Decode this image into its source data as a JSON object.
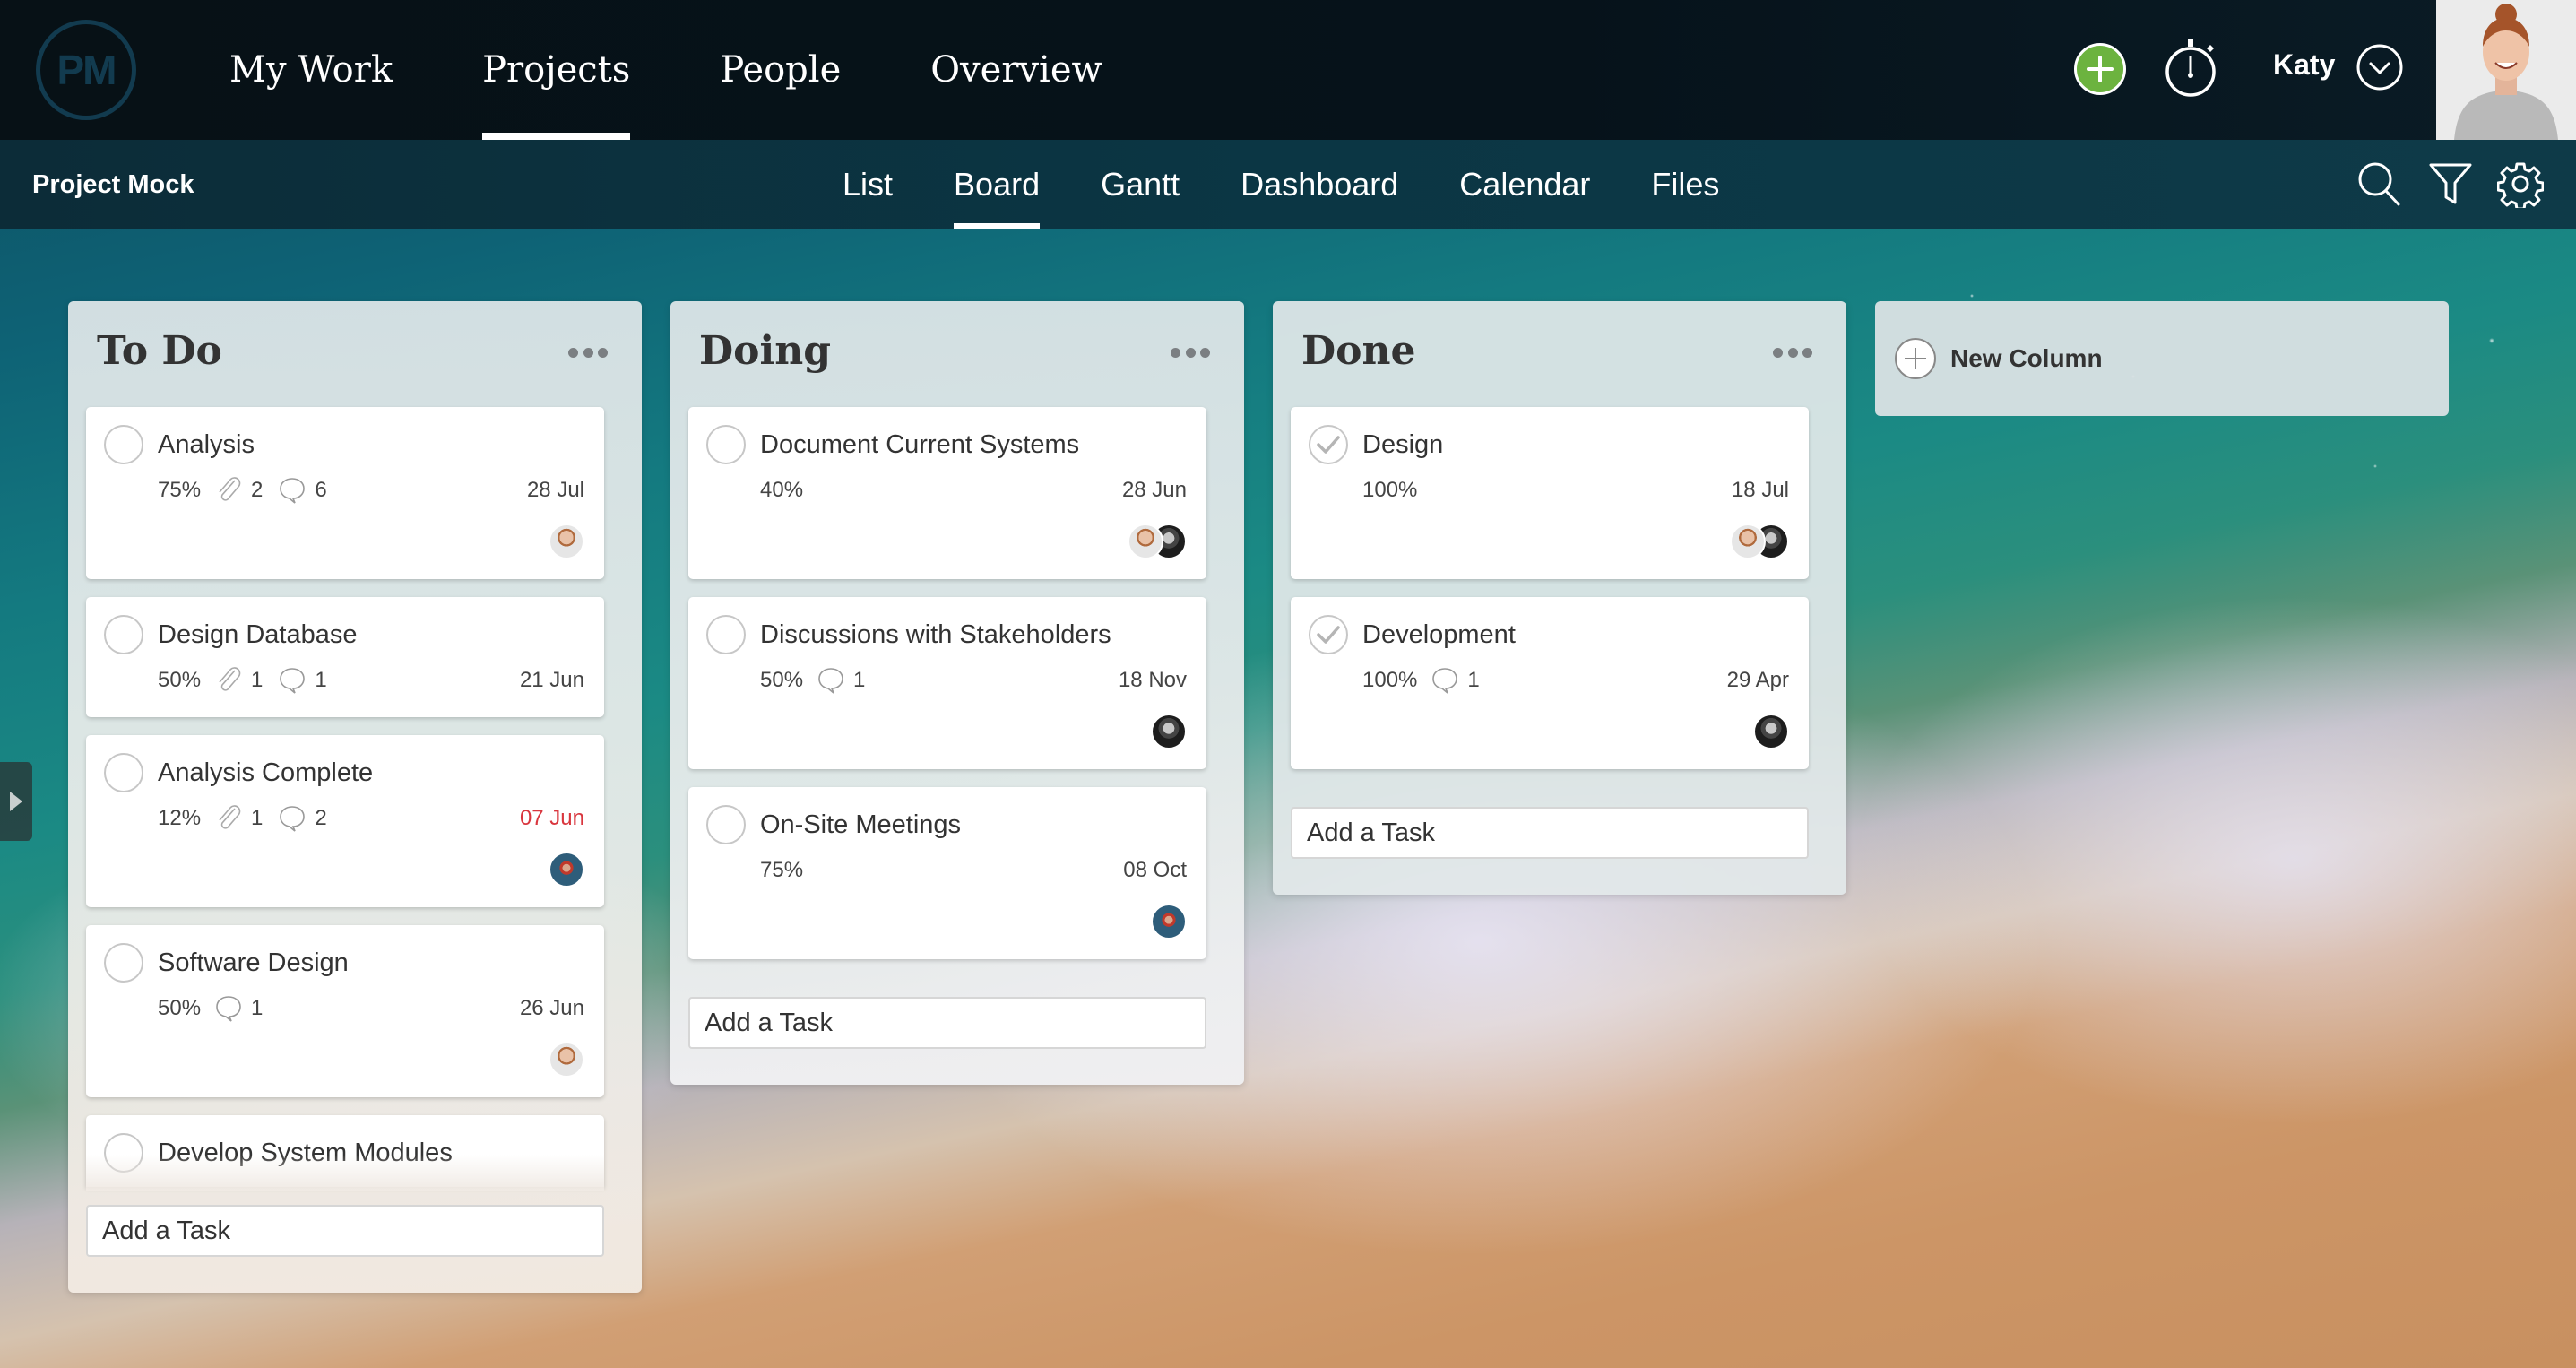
{
  "app": {
    "logo_text": "PM"
  },
  "main_nav": {
    "items": [
      {
        "label": "My Work",
        "active": false
      },
      {
        "label": "Projects",
        "active": true
      },
      {
        "label": "People",
        "active": false
      },
      {
        "label": "Overview",
        "active": false
      }
    ]
  },
  "header_actions": {
    "add_icon": "plus-circle-icon",
    "timer_icon": "stopwatch-icon",
    "user_name": "Katy",
    "user_menu_icon": "chevron-down-circle-icon",
    "add_color": "#6cb33f"
  },
  "project": {
    "name": "Project Mock"
  },
  "view_tabs": [
    {
      "label": "List",
      "active": false
    },
    {
      "label": "Board",
      "active": true
    },
    {
      "label": "Gantt",
      "active": false
    },
    {
      "label": "Dashboard",
      "active": false
    },
    {
      "label": "Calendar",
      "active": false
    },
    {
      "label": "Files",
      "active": false
    }
  ],
  "toolbar_icons": [
    "search-icon",
    "filter-icon",
    "gear-icon"
  ],
  "board": {
    "add_task_placeholder": "Add a Task",
    "new_column_label": "New Column",
    "overdue_color": "#d9363e",
    "columns": [
      {
        "title": "To Do",
        "cards": [
          {
            "title": "Analysis",
            "progress": "75%",
            "attachments": "2",
            "comments": "6",
            "due": "28 Jul",
            "overdue": false,
            "done": false,
            "assignees": [
              "katy"
            ]
          },
          {
            "title": "Design Database",
            "progress": "50%",
            "attachments": "1",
            "comments": "1",
            "due": "21 Jun",
            "overdue": false,
            "done": false,
            "assignees": []
          },
          {
            "title": "Analysis Complete",
            "progress": "12%",
            "attachments": "1",
            "comments": "2",
            "due": "07 Jun",
            "overdue": true,
            "done": false,
            "assignees": [
              "beach"
            ]
          },
          {
            "title": "Software Design",
            "progress": "50%",
            "attachments": null,
            "comments": "1",
            "due": "26 Jun",
            "overdue": false,
            "done": false,
            "assignees": [
              "katy"
            ]
          },
          {
            "title": "Develop System Modules",
            "progress": null,
            "attachments": null,
            "comments": null,
            "due": null,
            "overdue": false,
            "done": false,
            "assignees": []
          }
        ]
      },
      {
        "title": "Doing",
        "cards": [
          {
            "title": "Document Current Systems",
            "progress": "40%",
            "attachments": null,
            "comments": null,
            "due": "28 Jun",
            "overdue": false,
            "done": false,
            "assignees": [
              "katy",
              "brahms"
            ]
          },
          {
            "title": "Discussions with Stakeholders",
            "progress": "50%",
            "attachments": null,
            "comments": "1",
            "due": "18 Nov",
            "overdue": false,
            "done": false,
            "assignees": [
              "brahms"
            ]
          },
          {
            "title": "On-Site Meetings",
            "progress": "75%",
            "attachments": null,
            "comments": null,
            "due": "08 Oct",
            "overdue": false,
            "done": false,
            "assignees": [
              "beach"
            ]
          }
        ]
      },
      {
        "title": "Done",
        "cards": [
          {
            "title": "Design",
            "progress": "100%",
            "attachments": null,
            "comments": null,
            "due": "18 Jul",
            "overdue": false,
            "done": true,
            "assignees": [
              "katy",
              "brahms"
            ]
          },
          {
            "title": "Development",
            "progress": "100%",
            "attachments": null,
            "comments": "1",
            "due": "29 Apr",
            "overdue": false,
            "done": true,
            "assignees": [
              "brahms"
            ]
          }
        ]
      }
    ]
  }
}
